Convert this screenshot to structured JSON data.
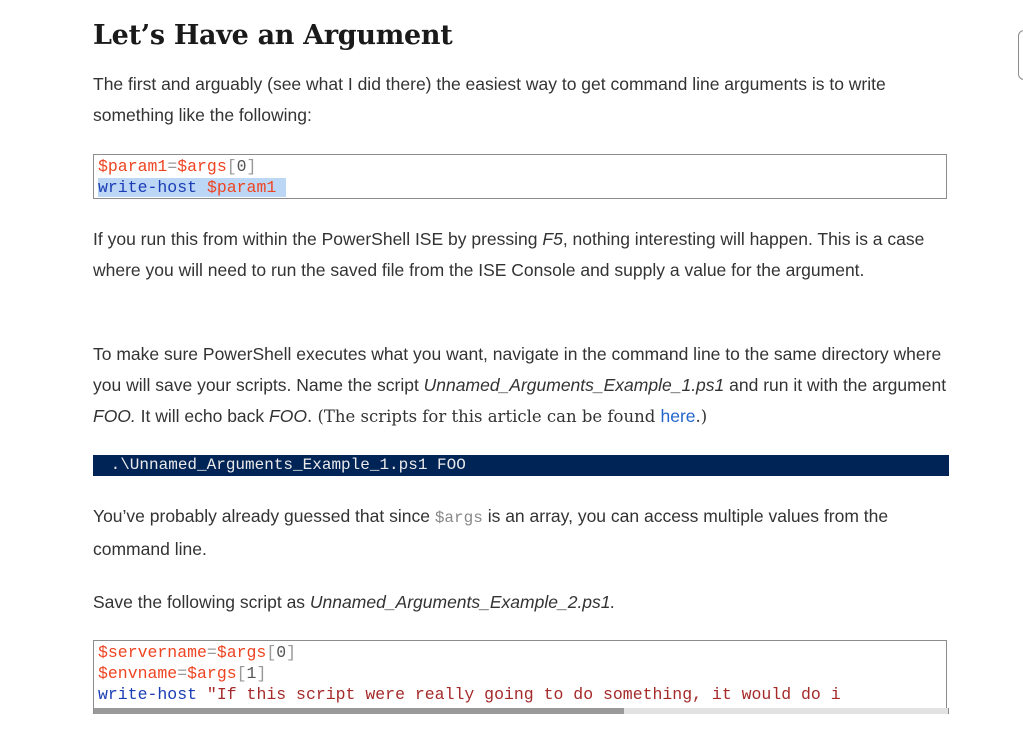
{
  "heading": "Let’s Have an Argument",
  "p1": {
    "text": "The first and arguably (see what I did there) the easiest way to get command line arguments is to write something like the following:"
  },
  "code1": {
    "line1": {
      "var1": "$param1",
      "eq": "=",
      "var2": "$args",
      "open": "[",
      "idx": "0",
      "close": "]"
    },
    "line2": {
      "cmd": "write-host",
      "arg": "$param1"
    }
  },
  "p2": {
    "before": "If you run this from within the PowerShell ISE by pressing ",
    "key": "F5",
    "after": ", nothing interesting will happen. This is a case where you will need to run the saved file from the ISE Console and supply a value for the argument."
  },
  "p3": {
    "t1": "To make sure PowerShell executes what you want, navigate in the command line to the same directory where you will save your scripts. Name the script ",
    "script": "Unnamed_Arguments_Example_1.ps1",
    "t2": " and run it with the argument ",
    "arg1": "FOO.",
    "t3": " It will echo back ",
    "arg2": "FOO",
    "t4": ". (The scripts for this article can be found ",
    "link": "here",
    "t5": ".)"
  },
  "console_line": " .\\Unnamed_Arguments_Example_1.ps1 FOO",
  "p4": {
    "t1": "You’ve probably already guessed that since ",
    "code": "$args",
    "t2": " is an array, you can access multiple values from the command line."
  },
  "p5": {
    "t1": "Save the following script as ",
    "script": "Unnamed_Arguments_Example_2.ps1."
  },
  "code3": {
    "line1": {
      "var1": "$servername",
      "eq": "=",
      "var2": "$args",
      "open": "[",
      "idx": "0",
      "close": "]"
    },
    "line2": {
      "var1": "$envname",
      "eq": "=",
      "var2": "$args",
      "open": "[",
      "idx": "1",
      "close": "]"
    },
    "line3": {
      "cmd": "write-host",
      "str": " \"If this script were really going to do something, it would do i"
    }
  },
  "colors": {
    "console_bg": "#012456",
    "link": "#2266cc",
    "variable": "#ee4422",
    "keyword": "#1a3db5",
    "string": "#a52a2a",
    "selection": "#bcd7f5"
  }
}
